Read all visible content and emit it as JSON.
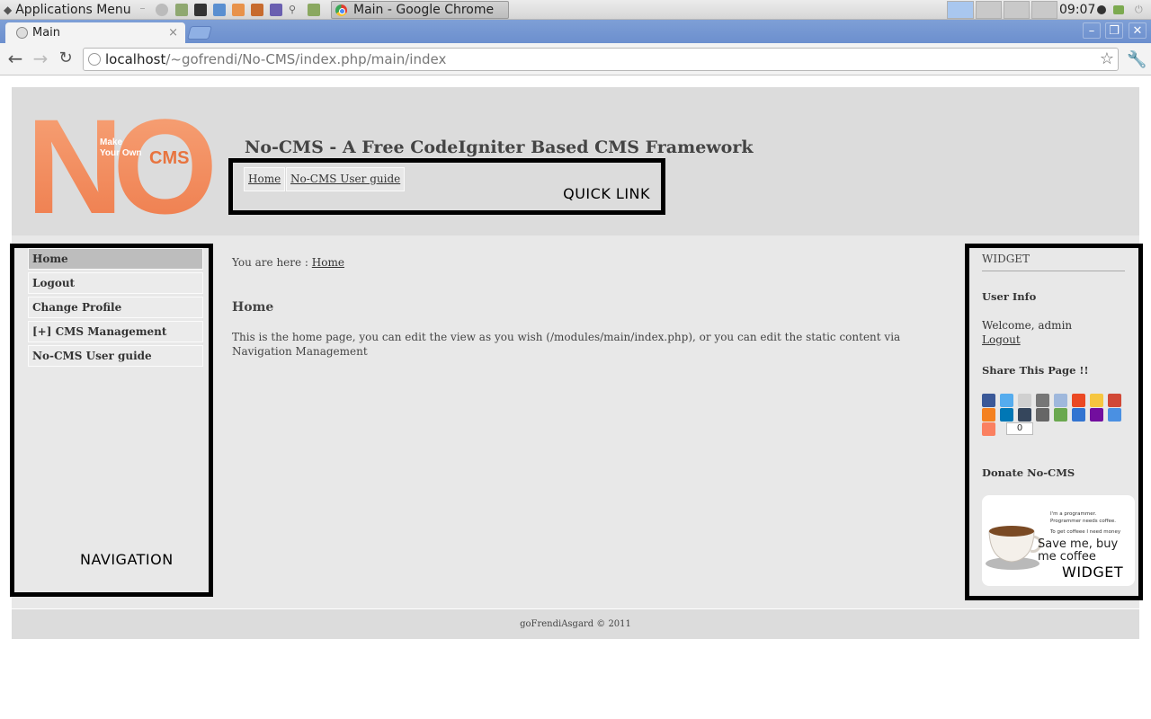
{
  "os": {
    "apps_menu_label": "Applications Menu",
    "window_button_label": "Main - Google Chrome",
    "clock": "09:07"
  },
  "browser": {
    "tab_title": "Main",
    "tab_close": "×",
    "url_host": "localhost",
    "url_path": "/~gofrendi/No-CMS/index.php/main/index"
  },
  "header": {
    "site_title": "No-CMS - A Free CodeIgniter Based CMS Framework",
    "logo": {
      "big": "NO",
      "small_line1": "Make",
      "small_line2": "Your Own",
      "cms": "CMS"
    },
    "quick_links": [
      "Home",
      "No-CMS User guide"
    ],
    "quick_link_annotation": "QUICK LINK"
  },
  "navigation": {
    "items": [
      {
        "label": "Home",
        "active": true
      },
      {
        "label": "Logout",
        "active": false
      },
      {
        "label": "Change Profile",
        "active": false
      },
      {
        "label": "[+]  CMS Management",
        "active": false
      },
      {
        "label": "No-CMS User guide",
        "active": false
      }
    ],
    "annotation": "NAVIGATION"
  },
  "main": {
    "breadcrumb_prefix": "You are here : ",
    "breadcrumb_link": "Home",
    "heading": "Home",
    "body": "This is the home page, you can edit the view as you wish (/modules/main/index.php), or you can edit the static content via Navigation Management"
  },
  "widget": {
    "title": "WIDGET",
    "user_info_heading": "User Info",
    "welcome": "Welcome, admin",
    "logout": "Logout",
    "share_heading": "Share This Page !!",
    "share_count": "0",
    "share_icons": [
      "facebook-icon",
      "twitter-icon",
      "email-icon",
      "print-icon",
      "reddit-icon",
      "stumbleupon-icon",
      "favorites-icon",
      "gmail-icon",
      "blogger-icon",
      "linkedin-icon",
      "tumblr-icon",
      "printfriendly-icon",
      "google-icon",
      "delicious-icon",
      "yahoo-icon",
      "messenger-icon",
      "more-icon"
    ],
    "share_colors": [
      "#3b5998",
      "#55acee",
      "#d0d0d0",
      "#777777",
      "#9fb8dc",
      "#eb4924",
      "#f6c640",
      "#d14836",
      "#f48120",
      "#0077b5",
      "#35465c",
      "#666666",
      "#6aa84f",
      "#3274d1",
      "#720e9e",
      "#4a90e2",
      "#fa8060"
    ],
    "donate_heading": "Donate No-CMS",
    "donate_small1": "I'm a programmer.",
    "donate_small2": "Programmer needs coffee.",
    "donate_small3": "To get coffeee I need money",
    "donate_big": "Save me, buy me coffee",
    "annotation": "WIDGET"
  },
  "footer": {
    "text": "goFrendiAsgard © 2011"
  }
}
